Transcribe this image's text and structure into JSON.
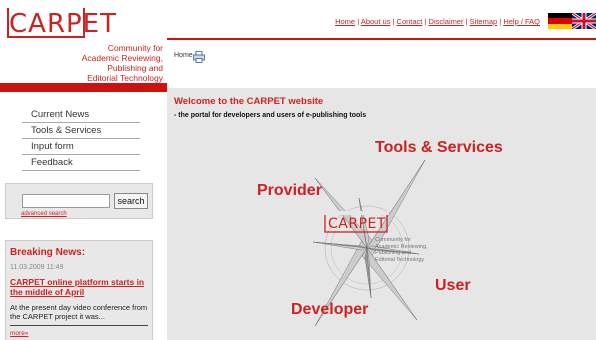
{
  "brand": {
    "logo": "CARPET",
    "tagline": [
      "Community for",
      "Academic Reviewing,",
      "Publishing and",
      "Editorial Technology"
    ]
  },
  "topnav": {
    "links": [
      "Home",
      "About us",
      "Contact",
      "Disclaimer",
      "Sitemap",
      "Help / FAQ"
    ],
    "languages": [
      "de-flag-icon",
      "uk-flag-icon"
    ]
  },
  "breadcrumb": {
    "text": "Home ::"
  },
  "sidebar": {
    "items": [
      {
        "label": "Current News"
      },
      {
        "label": "Tools & Services"
      },
      {
        "label": "Input form"
      },
      {
        "label": "Feedback"
      }
    ]
  },
  "search": {
    "value": "",
    "placeholder": "",
    "button_label": "search",
    "advanced_label": "advanced search"
  },
  "news": {
    "title": "Breaking News:",
    "date": "11.03.2009 11:49",
    "headline": "CARPET online platform starts in the middle of April",
    "body": "At the present day video conference from the CARPET project it was...",
    "more": "more»"
  },
  "main": {
    "welcome": "Welcome to the CARPET website",
    "portal": "- the portal for developers and users of e-publishing tools",
    "compass": {
      "tools": "Tools & Services",
      "provider": "Provider",
      "user": "User",
      "developer": "Developer",
      "logo": "CARPET",
      "logo_lines": [
        "Community for",
        "Academic Reviewing,",
        "Publishing and",
        "Editorial Technology"
      ]
    }
  },
  "colors": {
    "brand": "#cc2222",
    "panel": "#e6e6e6"
  }
}
